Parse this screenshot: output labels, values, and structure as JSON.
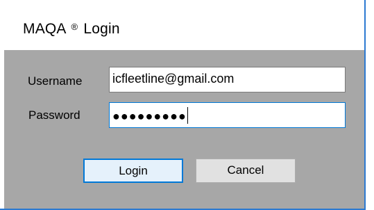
{
  "window": {
    "title_prefix": "MAQA",
    "title_mark": "®",
    "title_suffix": "Login"
  },
  "form": {
    "username_label": "Username",
    "username_value": "icfleetline@gmail.com",
    "password_label": "Password",
    "password_masked": "●●●●●●●●●"
  },
  "buttons": {
    "login_label": "Login",
    "cancel_label": "Cancel"
  },
  "colors": {
    "focus_border": "#0078d7",
    "client_background": "#a7a7a7"
  }
}
